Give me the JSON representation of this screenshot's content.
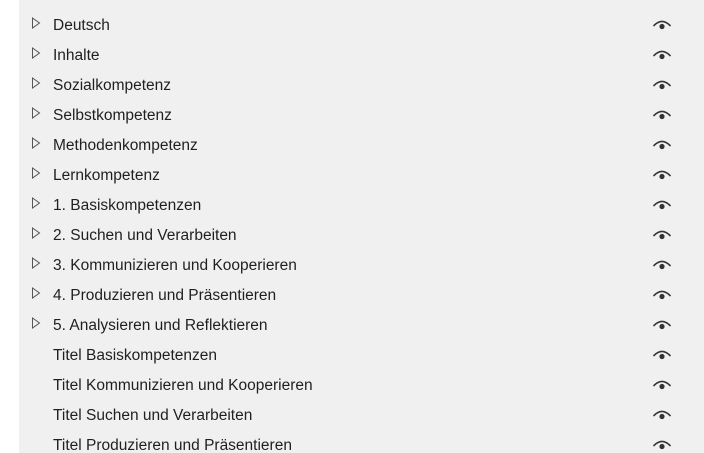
{
  "layers": [
    {
      "label": "Deutsch",
      "expandable": true,
      "icon": "eye-icon"
    },
    {
      "label": "Inhalte",
      "expandable": true,
      "icon": "eye-icon"
    },
    {
      "label": "Sozialkompetenz",
      "expandable": true,
      "icon": "eye-icon"
    },
    {
      "label": "Selbstkompetenz",
      "expandable": true,
      "icon": "eye-icon"
    },
    {
      "label": "Methodenkompetenz",
      "expandable": true,
      "icon": "eye-icon"
    },
    {
      "label": "Lernkompetenz",
      "expandable": true,
      "icon": "eye-icon"
    },
    {
      "label": "1. Basiskompetenzen",
      "expandable": true,
      "icon": "eye-icon"
    },
    {
      "label": "2. Suchen und Verarbeiten",
      "expandable": true,
      "icon": "eye-icon"
    },
    {
      "label": "3. Kommunizieren und Kooperieren",
      "expandable": true,
      "icon": "eye-icon"
    },
    {
      "label": "4. Produzieren und Präsentieren",
      "expandable": true,
      "icon": "eye-icon"
    },
    {
      "label": "5. Analysieren und Reflektieren",
      "expandable": true,
      "icon": "eye-icon"
    },
    {
      "label": "Titel Basiskompetenzen",
      "expandable": false,
      "icon": "eye-icon"
    },
    {
      "label": "Titel Kommunizieren und Kooperieren",
      "expandable": false,
      "icon": "eye-icon"
    },
    {
      "label": "Titel Suchen und Verarbeiten",
      "expandable": false,
      "icon": "eye-icon"
    },
    {
      "label": "Titel Produzieren und Präsentieren",
      "expandable": false,
      "icon": "eye-icon"
    }
  ],
  "colors": {
    "background": "#f0f0f0",
    "text": "#1f1f1f",
    "icon": "#333333",
    "expander": "#555555"
  }
}
